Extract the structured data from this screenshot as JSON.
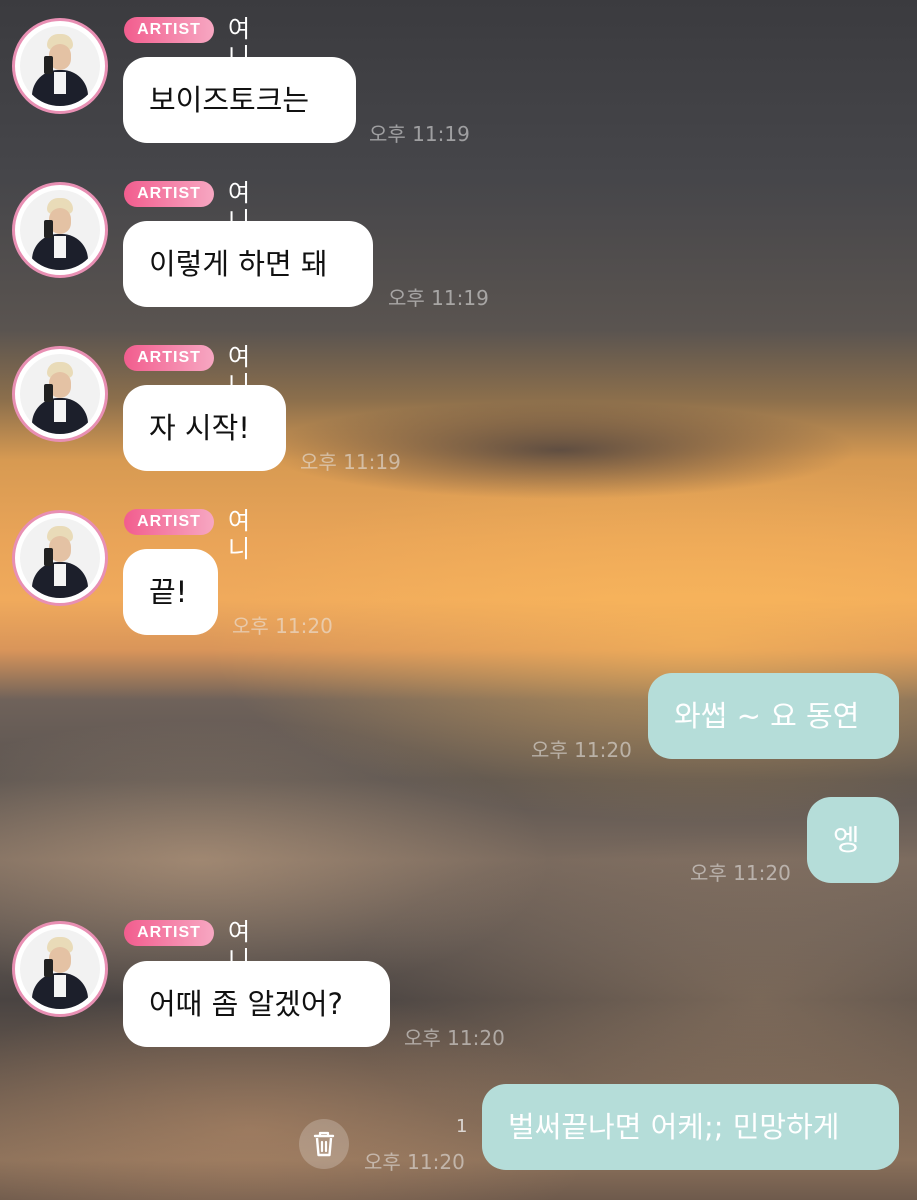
{
  "artist_badge": "ARTIST",
  "sender_name": "여니",
  "messages": [
    {
      "direction": "in",
      "text": "보이즈토크는",
      "time": "오후 11:19"
    },
    {
      "direction": "in",
      "text": "이렇게 하면 돼",
      "time": "오후 11:19"
    },
    {
      "direction": "in",
      "text": "자 시작!",
      "time": "오후 11:19"
    },
    {
      "direction": "in",
      "text": "끝!",
      "time": "오후 11:20"
    },
    {
      "direction": "out",
      "text": "와썹 ~ 요 동연",
      "time": "오후 11:20"
    },
    {
      "direction": "out",
      "text": "엥",
      "time": "오후 11:20"
    },
    {
      "direction": "in",
      "text": "어때 좀 알겠어?",
      "time": "오후 11:20"
    },
    {
      "direction": "out",
      "text": "벌써끝나면 어케;; 민망하게",
      "time": "오후 11:20",
      "unread_count": "1"
    }
  ],
  "icons": {
    "delete": "trash-icon",
    "avatar": "profile-photo"
  },
  "colors": {
    "badge": "#f25d8e",
    "avatar_ring": "#e88fb3",
    "outgoing_bubble": "#b5ddd9",
    "incoming_bubble": "#ffffff"
  }
}
